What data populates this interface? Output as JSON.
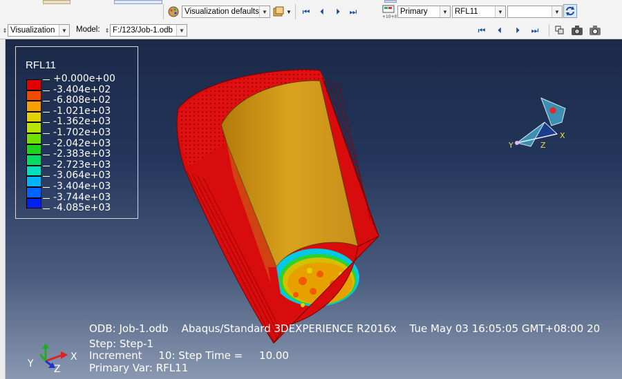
{
  "toolbar": {
    "viz_defaults": "Visualization defaults",
    "primary_label": "Primary",
    "field_output": "RFL11",
    "component": ""
  },
  "module_bar": {
    "module": "Visualization",
    "model_label": "Model:",
    "model_value": "F:/123/Job-1.odb"
  },
  "legend": {
    "title": "RFL11",
    "entries": [
      {
        "value": "+0.000e+00",
        "color": "#e00000"
      },
      {
        "value": "-3.404e+02",
        "color": "#f04a00"
      },
      {
        "value": "-6.808e+02",
        "color": "#f6a000"
      },
      {
        "value": "-1.021e+03",
        "color": "#e3d200"
      },
      {
        "value": "-1.362e+03",
        "color": "#b8e400"
      },
      {
        "value": "-1.702e+03",
        "color": "#6fe000"
      },
      {
        "value": "-2.042e+03",
        "color": "#1ed21e"
      },
      {
        "value": "-2.383e+03",
        "color": "#00dc64"
      },
      {
        "value": "-2.723e+03",
        "color": "#00e0c0"
      },
      {
        "value": "-3.064e+03",
        "color": "#00b4ff"
      },
      {
        "value": "-3.404e+03",
        "color": "#0064ff"
      },
      {
        "value": "-3.744e+03",
        "color": "#0020f0"
      },
      {
        "value": "-4.085e+03",
        "color": "#0000c8"
      }
    ]
  },
  "info": {
    "line1": "ODB: Job-1.odb    Abaqus/Standard 3DEXPERIENCE R2016x    Tue May 03 16:05:05 GMT+08:00 20",
    "line2": "Step: Step-1",
    "line3": "Increment     10: Step Time =     10.00",
    "line4": "Primary Var: RFL11"
  },
  "triad": {
    "x": "X",
    "y": "Y",
    "z": "Z"
  },
  "view_triad": {
    "x": "X",
    "y": "Y",
    "z": "Z"
  }
}
